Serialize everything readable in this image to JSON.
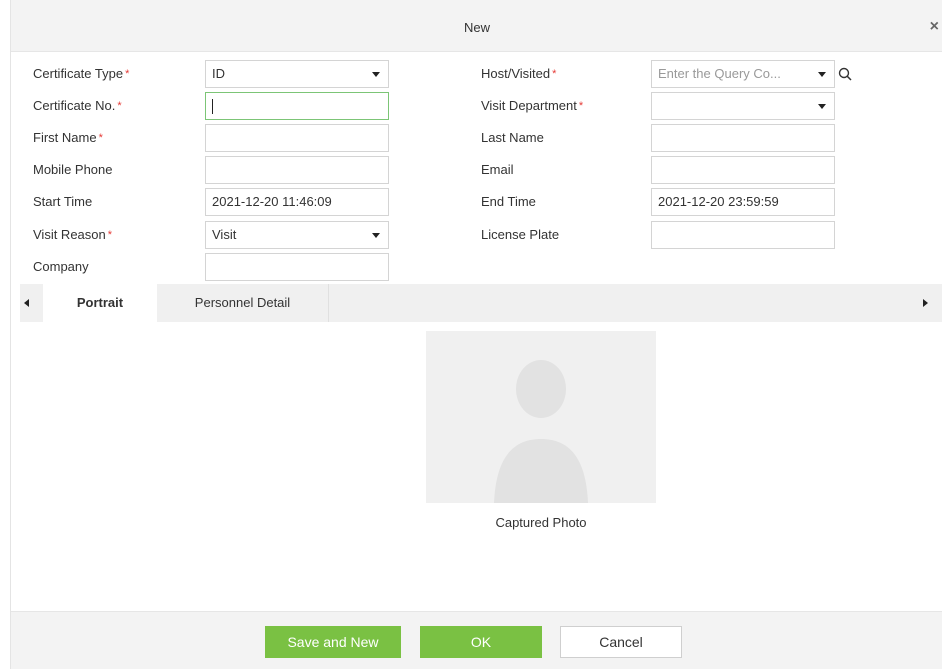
{
  "dialog": {
    "title": "New",
    "close_label": "×"
  },
  "form": {
    "certificate_type": {
      "label": "Certificate Type",
      "required": "*",
      "value": "ID"
    },
    "certificate_no": {
      "label": "Certificate No.",
      "required": "*",
      "value": ""
    },
    "first_name": {
      "label": "First Name",
      "required": "*",
      "value": ""
    },
    "mobile_phone": {
      "label": "Mobile Phone",
      "value": ""
    },
    "start_time": {
      "label": "Start Time",
      "value": "2021-12-20 11:46:09"
    },
    "visit_reason": {
      "label": "Visit Reason",
      "required": "*",
      "value": "Visit"
    },
    "company": {
      "label": "Company",
      "value": ""
    },
    "host_visited": {
      "label": "Host/Visited",
      "required": "*",
      "placeholder": "Enter the Query Co..."
    },
    "visit_department": {
      "label": "Visit Department",
      "required": "*",
      "value": ""
    },
    "last_name": {
      "label": "Last Name",
      "value": ""
    },
    "email": {
      "label": "Email",
      "value": ""
    },
    "end_time": {
      "label": "End Time",
      "value": "2021-12-20 23:59:59"
    },
    "license_plate": {
      "label": "License Plate",
      "value": ""
    }
  },
  "tabs": [
    {
      "label": "Portrait",
      "active": true
    },
    {
      "label": "Personnel Detail",
      "active": false
    }
  ],
  "portrait": {
    "caption": "Captured Photo"
  },
  "footer": {
    "save_new_label": "Save and New",
    "ok_label": "OK",
    "cancel_label": "Cancel"
  },
  "colors": {
    "accent_green": "#7ac143",
    "required_red": "#e53935",
    "focus_border": "#7cc576"
  }
}
